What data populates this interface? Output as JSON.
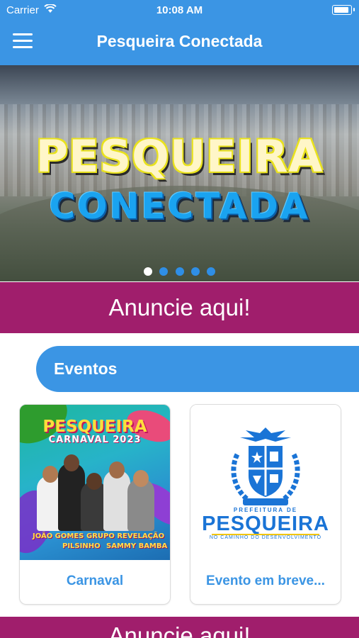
{
  "status_bar": {
    "carrier": "Carrier",
    "time": "10:08 AM"
  },
  "nav": {
    "title": "Pesqueira Conectada"
  },
  "carousel": {
    "line1": "PESQUEIRA",
    "line2": "CONECTADA",
    "slide_count": 5,
    "active_index": 0
  },
  "ads": {
    "label": "Anuncie aqui!",
    "color": "#a01e6c"
  },
  "section": {
    "title": "Eventos"
  },
  "events": [
    {
      "label": "Carnaval",
      "poster": {
        "title": "PESQUEIRA",
        "subtitle": "CARNAVAL 2023",
        "names": [
          "JOÃO GOMES",
          "GRUPO REVELAÇÃO",
          "PILSINHO",
          "SAMMY BAMBA"
        ]
      }
    },
    {
      "label": "Evento em breve...",
      "logo": {
        "small": "PREFEITURA DE",
        "big": "PESQUEIRA",
        "tagline": "NO CAMINHO DO DESENVOLVIMENTO"
      }
    }
  ],
  "colors": {
    "primary": "#3b95e4",
    "accent": "#a01e6c",
    "background": "#ffffff"
  }
}
